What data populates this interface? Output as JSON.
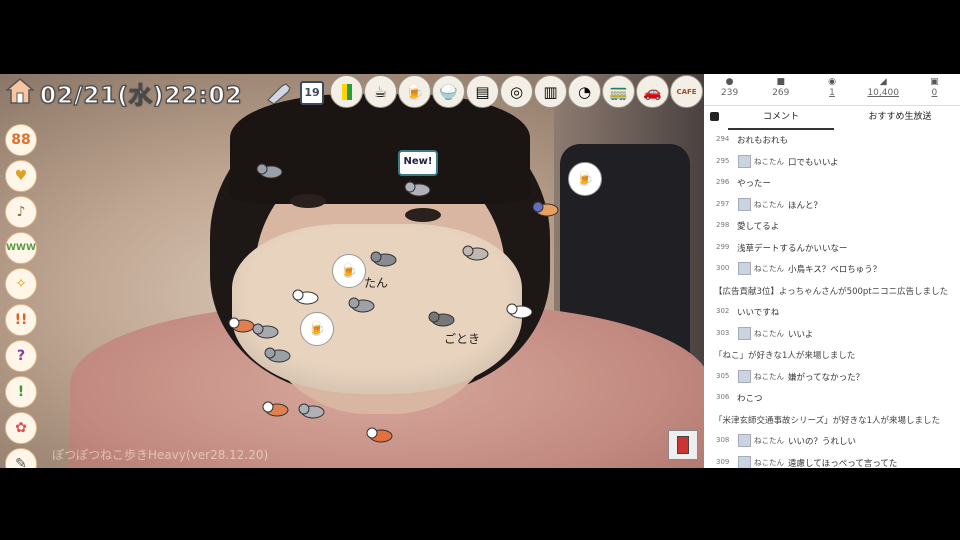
{
  "overlay": {
    "clock": "02/21(水)22:02",
    "day_badge": "19",
    "new_badge": "New!",
    "watermark": "ぽつぽつねこ歩きHeavy(ver28.12.20)",
    "text_tan": "たん",
    "text_tokiu": "ごとき",
    "top_icons": [
      "beginner-icon",
      "coffee-cup-icon",
      "drink-bottle-icon",
      "rice-bowl-icon",
      "notes-icon",
      "toilet-paper-icon",
      "cup-icon",
      "egg-icon",
      "train-icon",
      "car-icon",
      "cafe-icon"
    ],
    "cafe_label": "CAFE",
    "left_tools": [
      "88",
      "♥",
      "♪",
      "WWW",
      "✧",
      "!!",
      "?",
      "!",
      "✿",
      "✎"
    ]
  },
  "panel": {
    "stats": [
      {
        "icon": "viewer-icon",
        "value": "239"
      },
      {
        "icon": "comment-icon",
        "value": "269"
      },
      {
        "icon": "ad-icon",
        "value": "1"
      },
      {
        "icon": "gift-point-icon",
        "value": "10,400"
      },
      {
        "icon": "gift-icon",
        "value": "0"
      }
    ],
    "tabs": {
      "comment": "コメント",
      "recommend": "おすすめ生放送"
    },
    "comments": [
      {
        "num": "294",
        "name": "",
        "text": "おれもおれも"
      },
      {
        "num": "295",
        "name": "ねこたん",
        "text": "口でもいいよ"
      },
      {
        "num": "296",
        "name": "",
        "text": "やったー"
      },
      {
        "num": "297",
        "name": "ねこたん",
        "text": "ほんと？"
      },
      {
        "num": "298",
        "name": "",
        "text": "愛してるよ"
      },
      {
        "num": "299",
        "name": "",
        "text": "浅草デートするんかいいなー"
      },
      {
        "num": "300",
        "name": "ねこたん",
        "text": "小鳥キス？ベロちゅう？"
      },
      {
        "num": "",
        "name": "",
        "text": "【広告貢献3位】よっちゃんさんが500ptニコニ広告しました",
        "system": true
      },
      {
        "num": "302",
        "name": "",
        "text": "いいですね"
      },
      {
        "num": "303",
        "name": "ねこたん",
        "text": "いいよ"
      },
      {
        "num": "",
        "name": "",
        "text": "「ねこ」が好きな1人が来場しました",
        "system": true
      },
      {
        "num": "305",
        "name": "ねこたん",
        "text": "嫌がってなかった？"
      },
      {
        "num": "306",
        "name": "",
        "text": "わこつ"
      },
      {
        "num": "",
        "name": "",
        "text": "「米津玄師交通事故シリーズ」が好きな1人が来場しました",
        "system": true
      },
      {
        "num": "308",
        "name": "ねこたん",
        "text": "いいの？うれしい"
      },
      {
        "num": "309",
        "name": "ねこたん",
        "text": "遠慮してほっぺって言ってた"
      }
    ]
  }
}
